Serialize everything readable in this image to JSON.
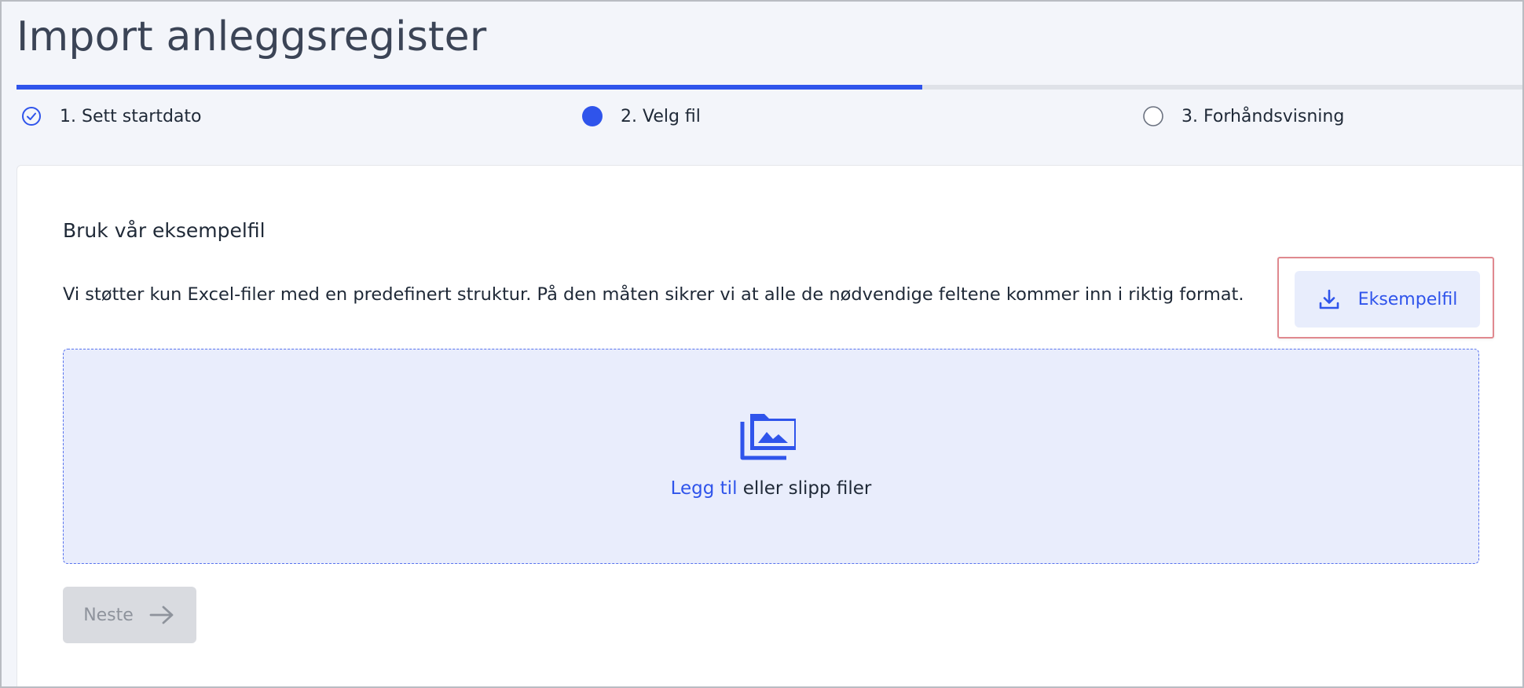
{
  "page": {
    "title": "Import anleggsregister"
  },
  "progress": {
    "completed_fraction": 0.6
  },
  "steps": [
    {
      "label": "1. Sett startdato",
      "state": "completed",
      "icon": "check-circle-icon"
    },
    {
      "label": "2. Velg fil",
      "state": "active",
      "icon": "filled-circle-icon"
    },
    {
      "label": "3. Forhåndsvisning",
      "state": "pending",
      "icon": "empty-circle-icon"
    }
  ],
  "content": {
    "section_title": "Bruk vår eksempelfil",
    "support_text": "Vi støtter kun Excel-filer med en predefinert struktur. På den måten sikrer vi at alle de nødvendige feltene kommer inn i riktig format.",
    "example_button_label": "Eksempelfil",
    "example_button_icon": "download-icon"
  },
  "dropzone": {
    "icon": "photo-library-icon",
    "link_text": "Legg til",
    "rest_text": " eller slipp filer"
  },
  "footer": {
    "next_button_label": "Neste",
    "next_button_icon": "arrow-right-icon",
    "next_button_disabled": true
  },
  "colors": {
    "accent": "#2f54eb",
    "accent_light": "#e8edfc",
    "disabled_bg": "#d9dbe0",
    "disabled_text": "#8e939c",
    "highlight_border": "#e0898f"
  }
}
